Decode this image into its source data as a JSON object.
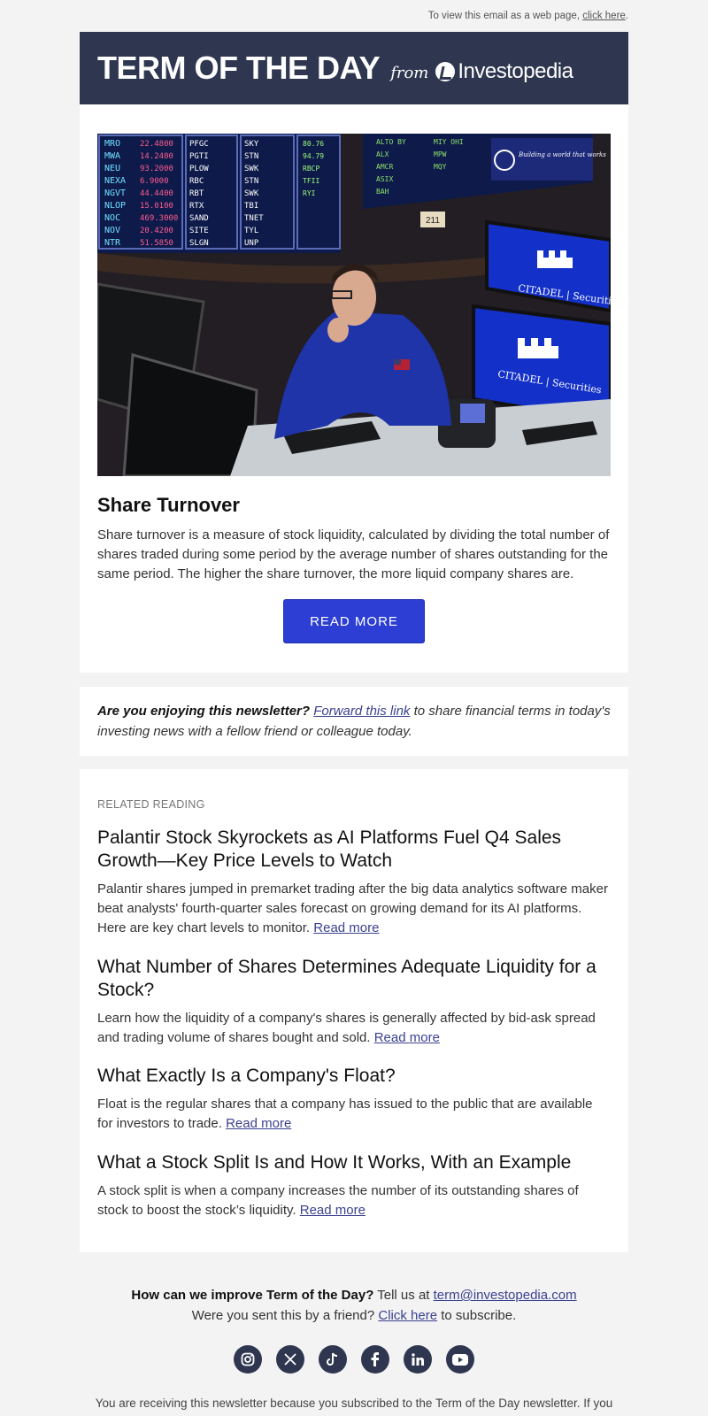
{
  "topline": {
    "text": "To view this email as a web page,",
    "link": "click here",
    "suffix": "."
  },
  "header": {
    "title": "TERM OF THE DAY",
    "from": "from",
    "brand": "Investopedia"
  },
  "term": {
    "title": "Share Turnover",
    "description": "Share turnover is a measure of stock liquidity, calculated by dividing the total number of shares traded during some period by the average number of shares outstanding for the same period. The higher the share turnover, the more liquid company shares are.",
    "button": "READ MORE"
  },
  "hero": {
    "screen_text_1": "CITADEL | Securities",
    "screen_text_2": "CITADEL | Securities",
    "post_number": "211"
  },
  "promo": {
    "lead": "Are you enjoying this newsletter?",
    "link": "Forward this link",
    "rest": " to share financial terms in today's investing news with a fellow friend or colleague today."
  },
  "related": {
    "label": "RELATED READING",
    "read_more": "Read more",
    "articles": [
      {
        "title": "Palantir Stock Skyrockets as AI Platforms Fuel Q4 Sales Growth—Key Price Levels to Watch",
        "text": "Palantir shares jumped in premarket trading after the big data analytics software maker beat analysts' fourth-quarter sales forecast on growing demand for its AI platforms. Here are key chart levels to monitor."
      },
      {
        "title": "What Number of Shares Determines Adequate Liquidity for a Stock?",
        "text": "Learn how the liquidity of a company's shares is generally affected by bid-ask spread and trading volume of shares bought and sold."
      },
      {
        "title": "What Exactly Is a Company's Float?",
        "text": "Float is the regular shares that a company has issued to the public that are available for investors to trade."
      },
      {
        "title": "What a Stock Split Is and How It Works, With an Example",
        "text": "A stock split is when a company increases the number of its outstanding shares of stock to boost the stock’s liquidity."
      }
    ]
  },
  "footer": {
    "q_bold": "How can we improve Term of the Day?",
    "q_rest": " Tell us at ",
    "email": "term@investopedia.com",
    "sent_text": "Were you sent this by a friend?",
    "sent_link": "Click here",
    "sent_suffix": " to subscribe.",
    "note": "You are receiving this newsletter because you subscribed to the Term of the Day newsletter. If you"
  },
  "socials": [
    "instagram-icon",
    "x-icon",
    "tiktok-icon",
    "facebook-icon",
    "linkedin-icon",
    "youtube-icon"
  ]
}
